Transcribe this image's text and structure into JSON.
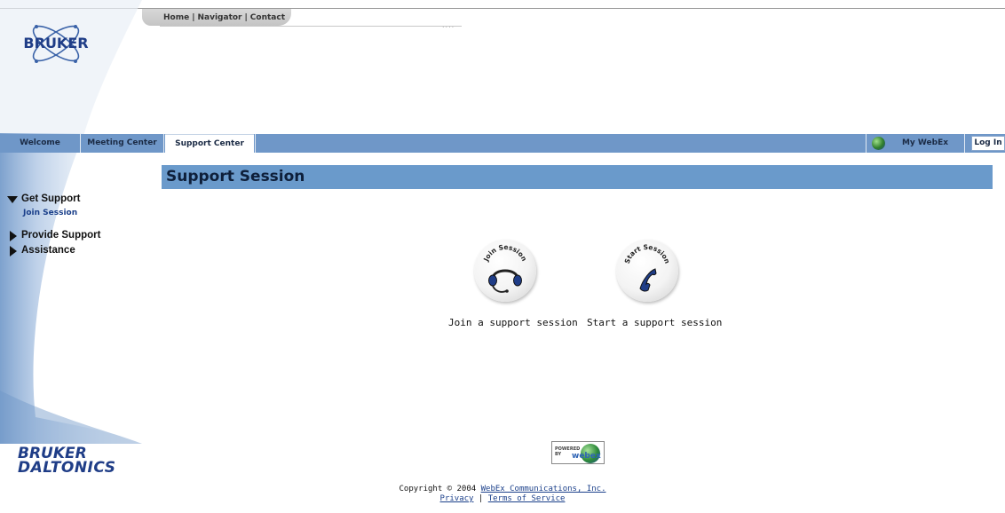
{
  "brand": {
    "logo_text": "BRUKER",
    "bottom_line1": "BRUKER",
    "bottom_line2": "DALTONICS"
  },
  "top_nav": {
    "links": [
      "Home",
      "Navigator",
      "Contact"
    ],
    "separator": "|"
  },
  "tabs": {
    "items": [
      "Welcome",
      "Meeting Center",
      "Support Center"
    ],
    "active": "Support Center",
    "my_webex": "My WebEx",
    "login": "Log In"
  },
  "sidebar": {
    "get_support": "Get Support",
    "join_session": "Join Session",
    "provide_support": "Provide Support",
    "assistance": "Assistance"
  },
  "page": {
    "title": "Support Session"
  },
  "options": {
    "join": {
      "badge": "Join Session",
      "label": "Join a support session",
      "icon": "headset-icon"
    },
    "start": {
      "badge": "Start Session",
      "label": "Start a support session",
      "icon": "phone-icon"
    }
  },
  "powered_badge": {
    "line1": "POWERED",
    "line2": "BY",
    "brand": "webex"
  },
  "footer": {
    "copyright": "Copyright © 2004",
    "company_link": "WebEx Communications, Inc.",
    "privacy": "Privacy",
    "separator": "|",
    "terms": "Terms of Service"
  },
  "colors": {
    "tab_bar": "#6f97c8",
    "section_header": "#6a9acb",
    "link": "#1a3f8a",
    "brand_blue": "#1f3d87"
  }
}
